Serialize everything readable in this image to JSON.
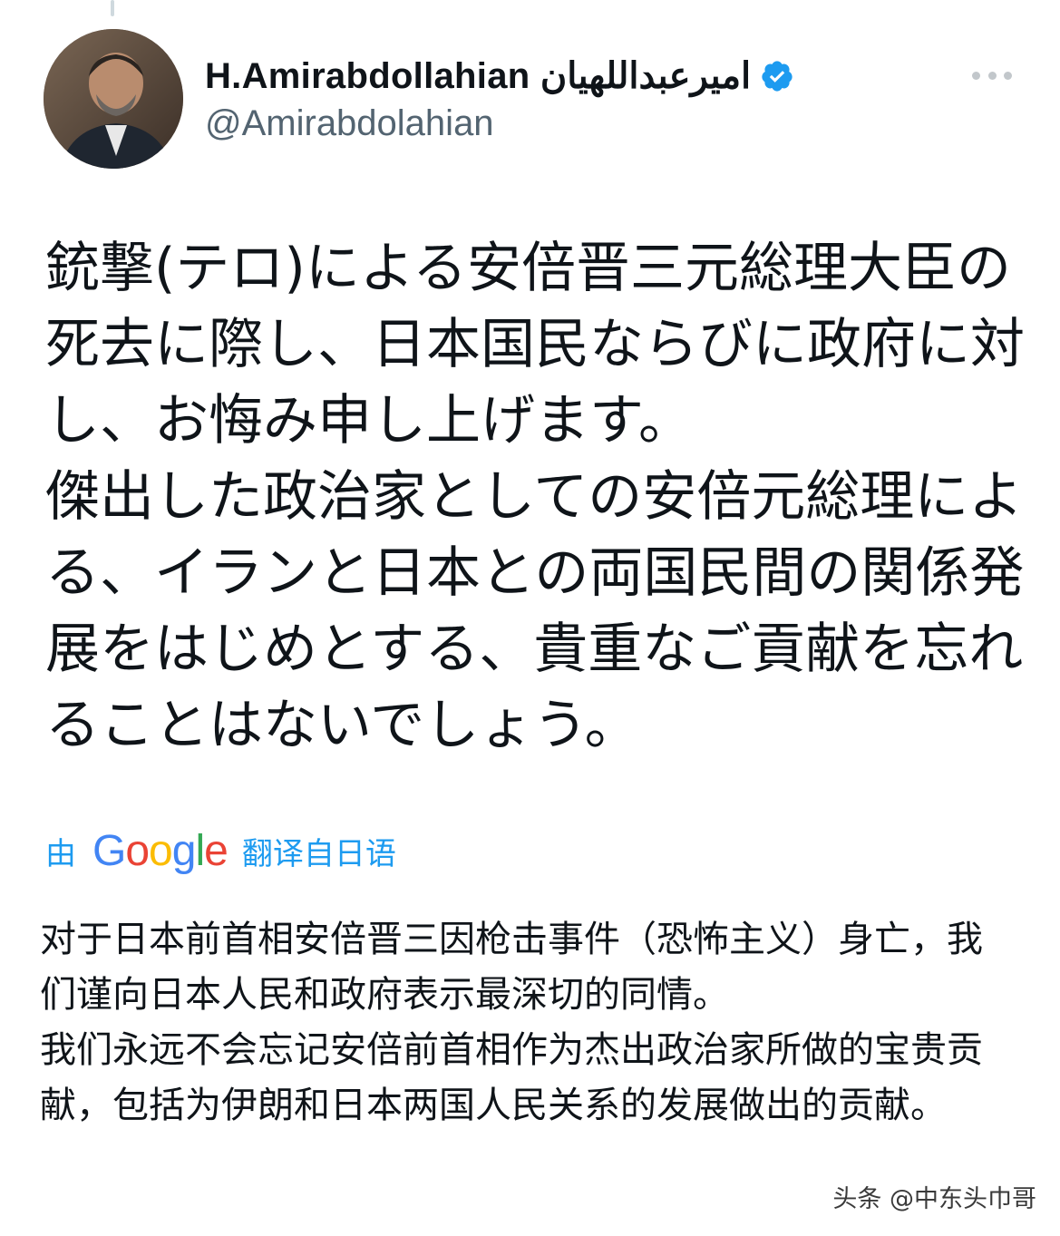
{
  "tweet": {
    "author": {
      "display_name": "H.Amirabdollahian امیرعبداللهیان",
      "handle": "@Amirabdolahian",
      "verified": true,
      "avatar_icon": "profile-photo"
    },
    "more_icon": "more-horizontal-icon",
    "text": "銃撃(テロ)による安倍晋三元総理大臣の死去に際し、日本国民ならびに政府に対し、お悔み申し上げます。\n傑出した政治家としての安倍元総理による、イランと日本との両国民間の関係発展をはじめとする、貴重なご貢献を忘れることはないでしょう。",
    "translation": {
      "prefix": "由",
      "provider": "Google",
      "suffix": "翻译自日语",
      "text": "对于日本前首相安倍晋三因枪击事件（恐怖主义）身亡，我们谨向日本人民和政府表示最深切的同情。\n我们永远不会忘记安倍前首相作为杰出政治家所做的宝贵贡献，包括为伊朗和日本两国人民关系的发展做出的贡献。"
    }
  },
  "watermark": "头条 @中东头巾哥",
  "colors": {
    "text": "#0f1419",
    "secondary": "#536471",
    "link": "#1d9bf0",
    "verified": "#1d9bf0"
  }
}
